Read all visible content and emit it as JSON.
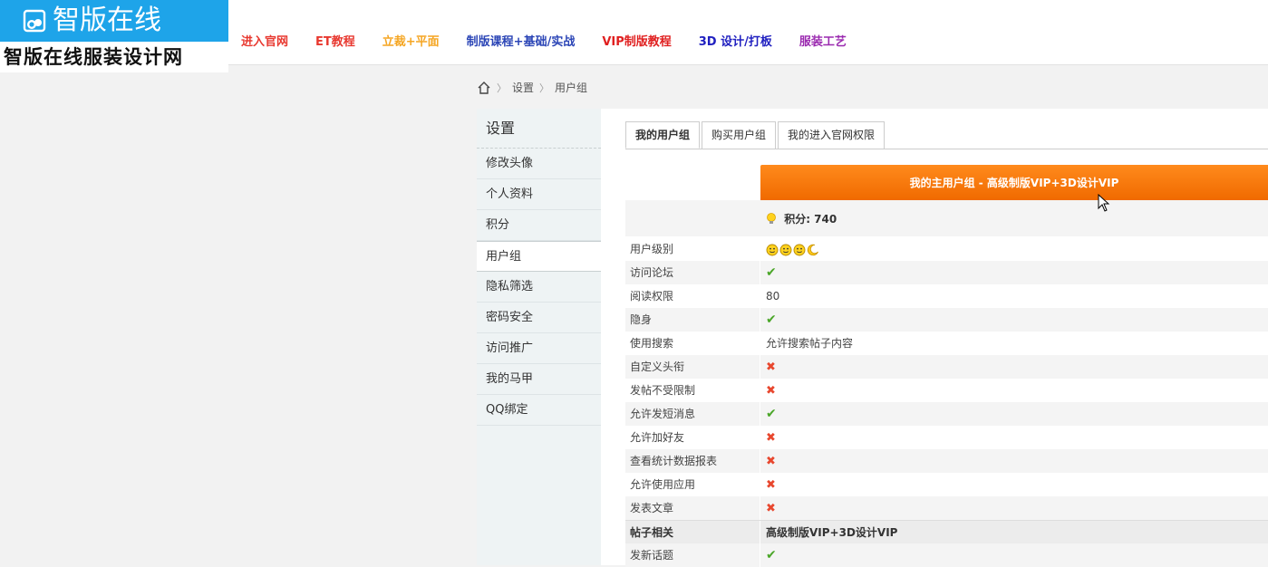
{
  "logo": {
    "title": "智版在线",
    "subtitle": "智版在线服装设计网"
  },
  "nav": [
    {
      "label": "进入官网",
      "color": "#e8382f"
    },
    {
      "label": "ET教程",
      "color": "#e8382f"
    },
    {
      "label": "立裁+平面",
      "color": "#f5a623"
    },
    {
      "label": "制版课程+基础/实战",
      "color": "#2b45b6"
    },
    {
      "label": "VIP制版教程",
      "color": "#e02020"
    },
    {
      "label": "3D 设计/打板",
      "color": "#2020c0"
    },
    {
      "label": "服装工艺",
      "color": "#9b2bb0"
    }
  ],
  "breadcrumb": {
    "items": [
      "设置",
      "用户组"
    ]
  },
  "sidebar": {
    "title": "设置",
    "items": [
      "修改头像",
      "个人资料",
      "积分",
      "用户组",
      "隐私筛选",
      "密码安全",
      "访问推广",
      "我的马甲",
      "QQ绑定"
    ],
    "active_index": 3
  },
  "tabs": [
    "我的用户组",
    "购买用户组",
    "我的进入官网权限"
  ],
  "group": {
    "header": "我的主用户组 - 高级制版VIP+3D设计VIP",
    "credit": "积分: 740"
  },
  "permissions": [
    {
      "label": "用户级别",
      "type": "faces"
    },
    {
      "label": "访问论坛",
      "type": "ok"
    },
    {
      "label": "阅读权限",
      "type": "text",
      "value": "80"
    },
    {
      "label": "隐身",
      "type": "ok"
    },
    {
      "label": "使用搜索",
      "type": "text",
      "value": "允许搜索帖子内容"
    },
    {
      "label": "自定义头衔",
      "type": "no"
    },
    {
      "label": "发帖不受限制",
      "type": "no"
    },
    {
      "label": "允许发短消息",
      "type": "ok"
    },
    {
      "label": "允许加好友",
      "type": "no"
    },
    {
      "label": "查看统计数据报表",
      "type": "no"
    },
    {
      "label": "允许使用应用",
      "type": "no"
    },
    {
      "label": "发表文章",
      "type": "no"
    }
  ],
  "section": {
    "label": "帖子相关",
    "value": "高级制版VIP+3D设计VIP"
  },
  "post_permissions": [
    {
      "label": "发新话题",
      "type": "ok"
    }
  ],
  "colors": {
    "accent": "#f47a0b",
    "ok": "#4aa628",
    "no": "#e8472e",
    "logo_bg": "#1ea4e9"
  },
  "glyphs": {
    "ok": "✔",
    "no": "✖"
  }
}
